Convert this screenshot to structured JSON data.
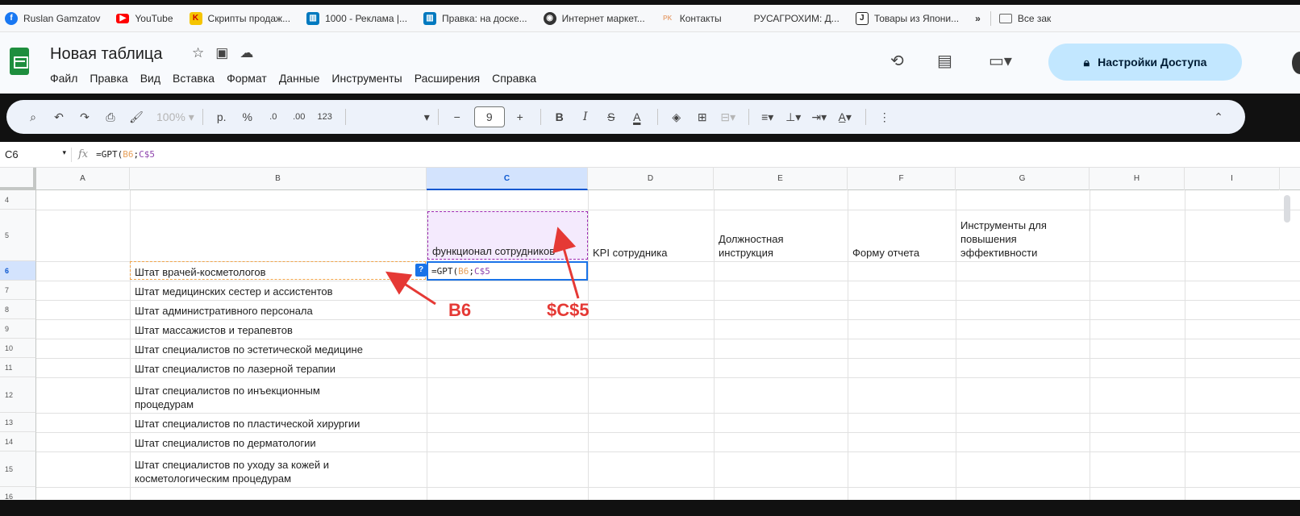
{
  "bookmarks": [
    {
      "label": "Ruslan Gamzatov",
      "icon": "facebook-icon",
      "color": "#1877f2"
    },
    {
      "label": "YouTube",
      "icon": "youtube-icon",
      "color": "#ff0000"
    },
    {
      "label": "Скрипты продаж...",
      "icon": "k-letter-icon",
      "color": "#f5c400"
    },
    {
      "label": "1000 - Реклама |...",
      "icon": "trello-icon",
      "color": "#0079bf"
    },
    {
      "label": "Правка: на доске...",
      "icon": "trello-icon",
      "color": "#0079bf"
    },
    {
      "label": "Интернет маркет...",
      "icon": "globe-icon",
      "color": "#333333"
    },
    {
      "label": "Контакты",
      "icon": "rk-icon",
      "color": "#e8a87c"
    },
    {
      "label": "РУСАГРОХИМ: Д...",
      "icon": "blank-icon",
      "color": "#ffffff"
    },
    {
      "label": "Товары из Япони...",
      "icon": "j-letter-icon",
      "color": "#222222"
    }
  ],
  "bookmarks_more": "»",
  "bookmarks_folder": "Все зак",
  "doc": {
    "title": "Новая таблица",
    "menu": [
      "Файл",
      "Правка",
      "Вид",
      "Вставка",
      "Формат",
      "Данные",
      "Инструменты",
      "Расширения",
      "Справка"
    ],
    "share_label": "Настройки Доступа"
  },
  "toolbar": {
    "zoom": "100%",
    "currency": "р.",
    "percent": "%",
    "dec_decrease": ".0",
    "dec_increase": ".00",
    "number_format": "123",
    "font_size": "9",
    "minus": "−",
    "plus": "+",
    "bold": "B",
    "italic": "I",
    "strike": "S",
    "text_color": "A"
  },
  "formula_bar": {
    "cell_ref": "C6",
    "prefix": "=GPT(",
    "ref1": "B6",
    "sep": ";",
    "ref2": "C$5",
    "cell_prefix": "=GPT(",
    "cell_ref1": "B6",
    "cell_sep": ";",
    "cell_ref2": "C$5"
  },
  "grid": {
    "columns": [
      "A",
      "B",
      "C",
      "D",
      "E",
      "F",
      "G",
      "H",
      "I"
    ],
    "selected_column": "C",
    "rows": [
      "4",
      "5",
      "6",
      "7",
      "8",
      "9",
      "10",
      "11",
      "12",
      "13",
      "14",
      "15",
      "16"
    ],
    "selected_row": "6",
    "headers": {
      "c5": "функционал сотрудников",
      "d5": "KPI сотрудника",
      "e5": "Должностная инструкция",
      "f5": "Форму отчета",
      "g5": "Инструменты для повышения эффективности"
    },
    "b_values": [
      "Штат врачей-косметологов",
      "Штат медицинских сестер и ассистентов",
      "Штат административного персонала",
      "Штат массажистов и терапевтов",
      "Штат специалистов по эстетической медицине",
      "Штат специалистов по лазерной терапии",
      "Штат специалистов по инъекционным процедурам",
      "Штат специалистов по пластической хирургии",
      "Штат специалистов по дерматологии",
      "Штат специалистов по уходу за кожей и косметологическим процедурам"
    ]
  },
  "annotations": {
    "b6_label": "B6",
    "c5_label": "$C$5",
    "color": "#e53935"
  }
}
